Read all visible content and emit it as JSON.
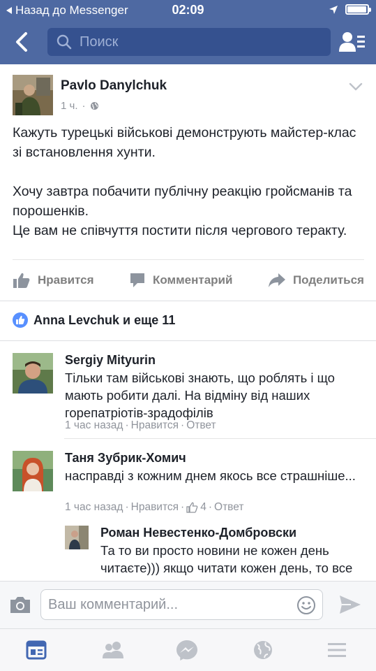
{
  "status_bar": {
    "back_to_app": "Назад до Messenger",
    "time": "02:09",
    "battery_level": 0.9
  },
  "header": {
    "search_placeholder": "Поиск"
  },
  "post": {
    "author": "Pavlo Danylchuk",
    "time": "1 ч.",
    "dot": "·",
    "paragraphs": [
      "Кажуть турецькі військові демонструють майстер-клас зі встановлення хунти.",
      "Хочу завтра побачити публічну реакцію гройсманів та порошенків.\nЦе вам не співчуття постити після чергового теракту."
    ],
    "actions": {
      "like": "Нравится",
      "comment": "Комментарий",
      "share": "Поделиться"
    },
    "likes_summary": "Anna Levchuk и еще 11"
  },
  "comments": [
    {
      "name": "Sergiy Mityurin",
      "text": "Тільки там військові знають, що роблять і що мають робити далі. На відміну від наших горепатріотів-зрадофілів",
      "time": "1 час назад",
      "like": "Нравится",
      "reply": "Ответ",
      "sep": "·"
    },
    {
      "name": "Таня Зубрик-Хомич",
      "text": "насправді з кожним днем якось все страшніше...",
      "time": "1 час назад",
      "like": "Нравится",
      "like_count": "4",
      "reply": "Ответ",
      "sep": "·"
    },
    {
      "name": "Роман Невестенко-Домбровски",
      "text": "Та то ви просто новини не кожен день читаєте))) якщо читати кожен день, то все не так страшно"
    }
  ],
  "composer": {
    "placeholder": "Ваш комментарий..."
  },
  "colors": {
    "header": "#4e69a2",
    "search_bg": "#35518f",
    "like_blue": "#5890ff",
    "meta_gray": "#90949c"
  },
  "tabbar": {
    "tabs": [
      "news-feed-icon",
      "friends-icon",
      "messenger-icon",
      "notifications-globe-icon",
      "menu-icon"
    ],
    "active": "news-feed-icon"
  }
}
